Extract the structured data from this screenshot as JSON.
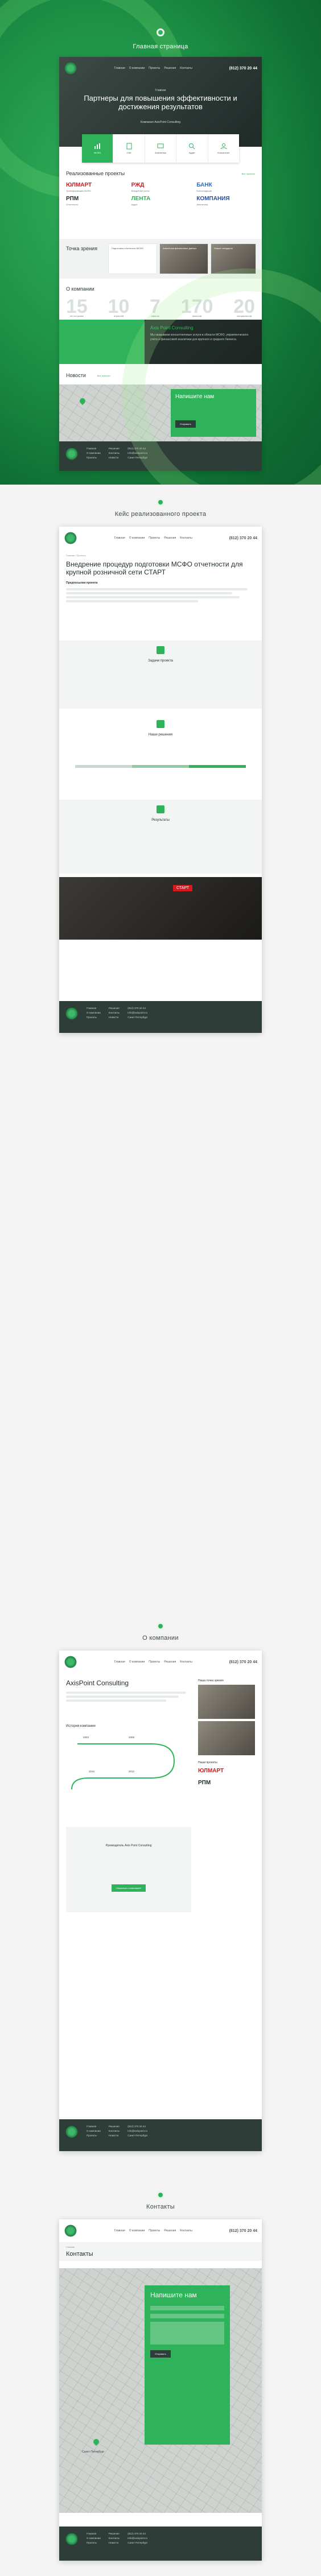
{
  "sections": {
    "home": "Главная страница",
    "case": "Кейс реализованного проекта",
    "about": "О компании",
    "contacts": "Контакты"
  },
  "header": {
    "nav": [
      "Главная",
      "О компании",
      "Проекты",
      "Решения",
      "Контакты"
    ],
    "phone": "(812) 370 20 44"
  },
  "home": {
    "hero_kicker": "Главная",
    "hero_title": "Партнеры для повышения эффективности и достижения результатов",
    "hero_sub": "Компания AxisPoint Consulting",
    "tiles": [
      "МСФО",
      "Учет",
      "Аналитика",
      "Аудит",
      "Консалтинг"
    ],
    "projects_title": "Реализованные проекты",
    "all_projects": "Все проекты",
    "clients": [
      {
        "name": "ЮЛМАРТ",
        "note": "Трансформация МСФО",
        "color": "#d7191f"
      },
      {
        "name": "РЖД",
        "note": "Внедрение учета",
        "color": "#d7191f"
      },
      {
        "name": "БАНК",
        "note": "Консолидация",
        "color": "#2b6fc4"
      },
      {
        "name": "РПМ",
        "note": "Отчетность",
        "color": "#1f2e29"
      },
      {
        "name": "ЛЕНТА",
        "note": "Аудит",
        "color": "#2fb35a"
      },
      {
        "name": "КОМПАНИЯ",
        "note": "Аналитика",
        "color": "#2b4fa0"
      }
    ],
    "views_title": "Точка зрения",
    "views": [
      "Подготовка отчетности МСФО",
      "Аналитика финансовых данных",
      "Новые стандарты"
    ],
    "about_title": "О компании",
    "numbers": [
      {
        "n": "15",
        "l": "лет на рынке"
      },
      {
        "n": "10",
        "l": "отраслей"
      },
      {
        "n": "7",
        "l": "офисов"
      },
      {
        "n": "170",
        "l": "проектов"
      },
      {
        "n": "20",
        "l": "специалистов"
      }
    ],
    "company_name": "Axis Point Consulting",
    "company_text": "Мы оказываем консалтинговые услуги в области МСФО, управленческого учета и финансовой аналитики для крупного и среднего бизнеса.",
    "news_title": "Новости",
    "all_news": "Все новости",
    "contact_title": "Напишите нам",
    "send": "Отправить"
  },
  "case": {
    "breadcrumb": "Главная / Проекты",
    "title": "Внедрение процедур подготовки МСФО отчетности для крупной розничной сети СТАРТ",
    "lead": "Предпосылки проекта",
    "tasks_title": "Задачи проекта",
    "solutions_title": "Наши решения",
    "results_title": "Результаты",
    "photo_label": "СТАРТ"
  },
  "about": {
    "title": "AxisPoint Consulting",
    "history_title": "История компании",
    "years": [
      "2003",
      "2008",
      "2012",
      "2015"
    ],
    "views_side": "Наша точка зрения",
    "projects_side": "Наши проекты",
    "quote_author": "Руководитель Axis Point Consulting",
    "cta": "Связаться с компанией"
  },
  "contacts": {
    "breadcrumb": "Главная",
    "title": "Контакты",
    "form_title": "Напишите нам",
    "address": "Санкт-Петербург",
    "send": "Отправить"
  },
  "footer": {
    "cols": [
      [
        "Главная",
        "О компании",
        "Проекты"
      ],
      [
        "Решения",
        "Контакты",
        "Новости"
      ],
      [
        "(812) 370 20 44",
        "info@axispoint.ru",
        "Санкт-Петербург"
      ]
    ]
  }
}
